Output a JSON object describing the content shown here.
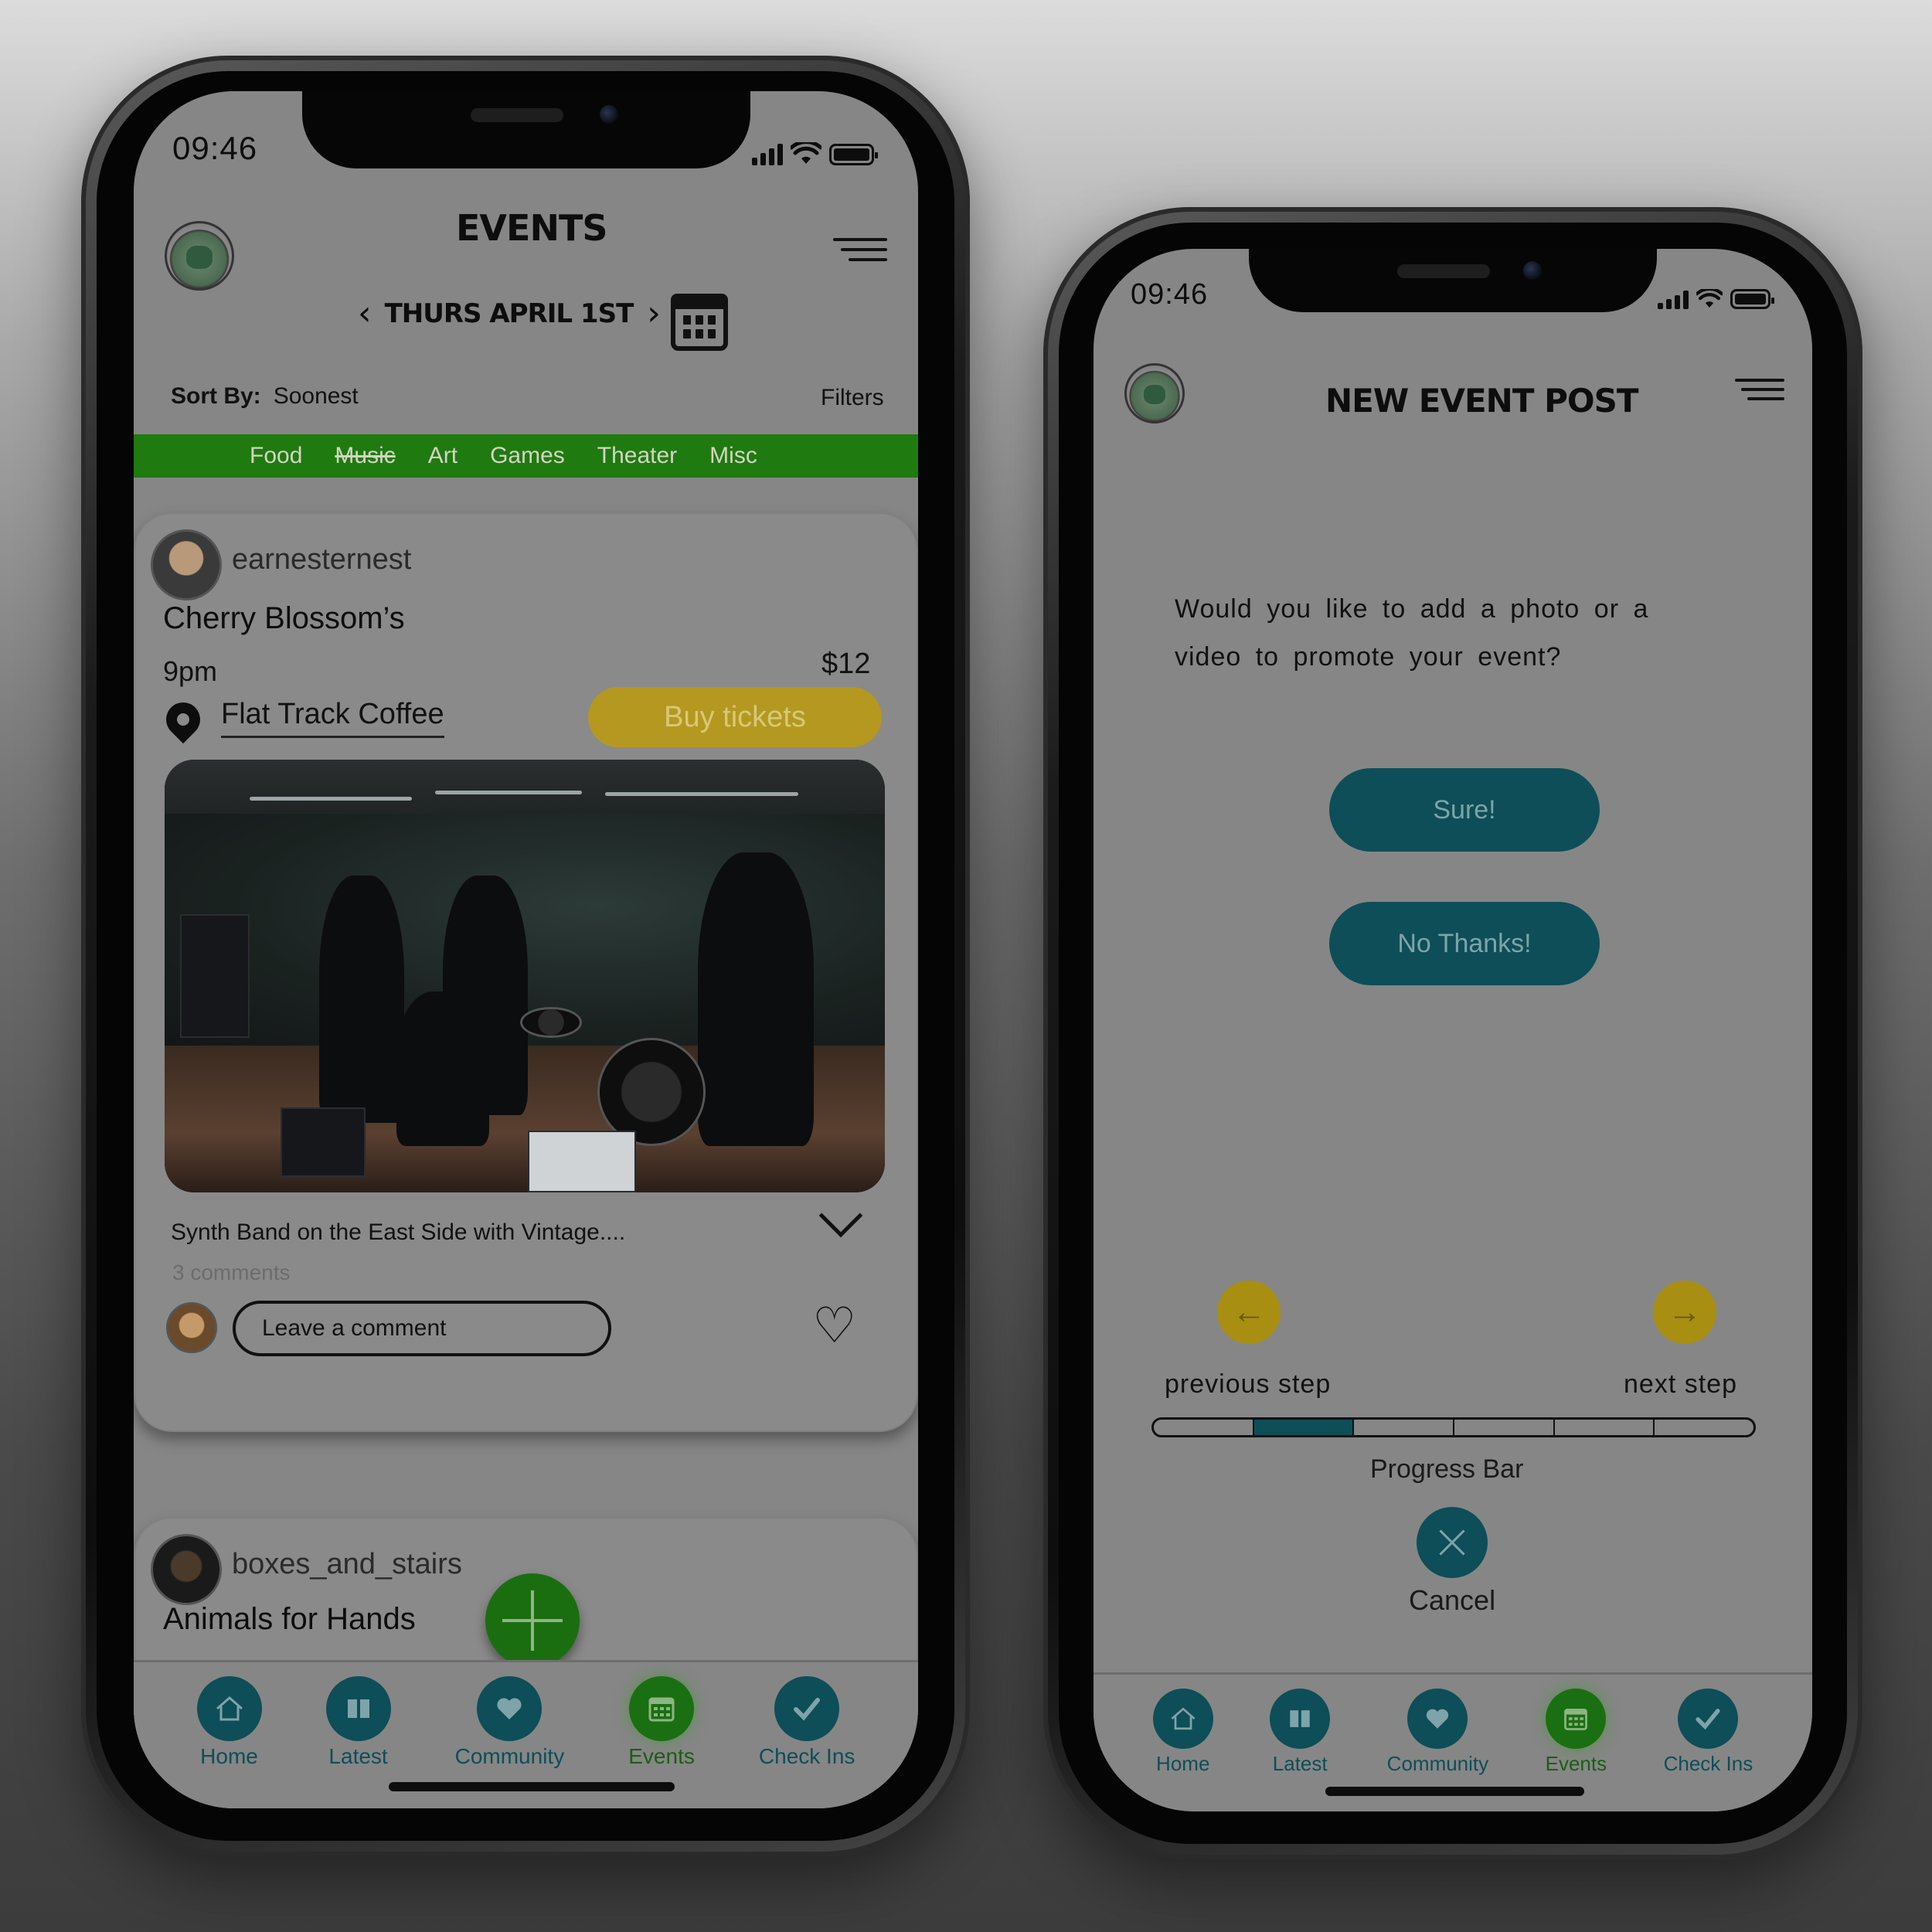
{
  "left_phone": {
    "status": {
      "time": "09:46"
    },
    "header": {
      "title": "EVENTS",
      "date": "THURS APRIL 1ST",
      "prev_icon": "chevron-left-icon",
      "next_icon": "chevron-right-icon"
    },
    "sort": {
      "label": "Sort By:",
      "value": "Soonest",
      "filters": "Filters"
    },
    "categories": [
      {
        "label": "Food"
      },
      {
        "label": "Music",
        "struck": true
      },
      {
        "label": "Art"
      },
      {
        "label": "Games"
      },
      {
        "label": "Theater"
      },
      {
        "label": "Misc"
      }
    ],
    "post1": {
      "username": "earnesternest",
      "title": "Cherry Blossom’s",
      "time": "9pm",
      "price": "$12",
      "venue": "Flat Track Coffee",
      "buy_label": "Buy tickets",
      "description": "Synth Band on the East Side with Vintage....",
      "comments": "3 comments",
      "comment_placeholder": "Leave a comment"
    },
    "post2": {
      "username": "boxes_and_stairs",
      "title": "Animals for Hands"
    },
    "tabs": [
      {
        "label": "Home",
        "icon": "home-icon"
      },
      {
        "label": "Latest",
        "icon": "book-icon"
      },
      {
        "label": "Community",
        "icon": "heart-icon"
      },
      {
        "label": "Events",
        "icon": "calendar-icon",
        "active": true
      },
      {
        "label": "Check Ins",
        "icon": "check-icon"
      }
    ]
  },
  "right_phone": {
    "status": {
      "time": "09:46"
    },
    "header": {
      "title": "NEW EVENT POST"
    },
    "question": "Would you like to add a photo or a video to promote your event?",
    "sure_label": "Sure!",
    "no_label": "No Thanks!",
    "prev_label": "previous step",
    "next_label": "next step",
    "progress_label": "Progress Bar",
    "progress": {
      "segments": 6,
      "current_step": 2
    },
    "cancel_label": "Cancel",
    "tabs": [
      {
        "label": "Home",
        "icon": "home-icon"
      },
      {
        "label": "Latest",
        "icon": "book-icon"
      },
      {
        "label": "Community",
        "icon": "heart-icon"
      },
      {
        "label": "Events",
        "icon": "calendar-icon",
        "active": true
      },
      {
        "label": "Check Ins",
        "icon": "check-icon"
      }
    ]
  },
  "colors": {
    "accent_green": "#1f7a10",
    "teal": "#0d4e58",
    "gold": "#b59820"
  }
}
